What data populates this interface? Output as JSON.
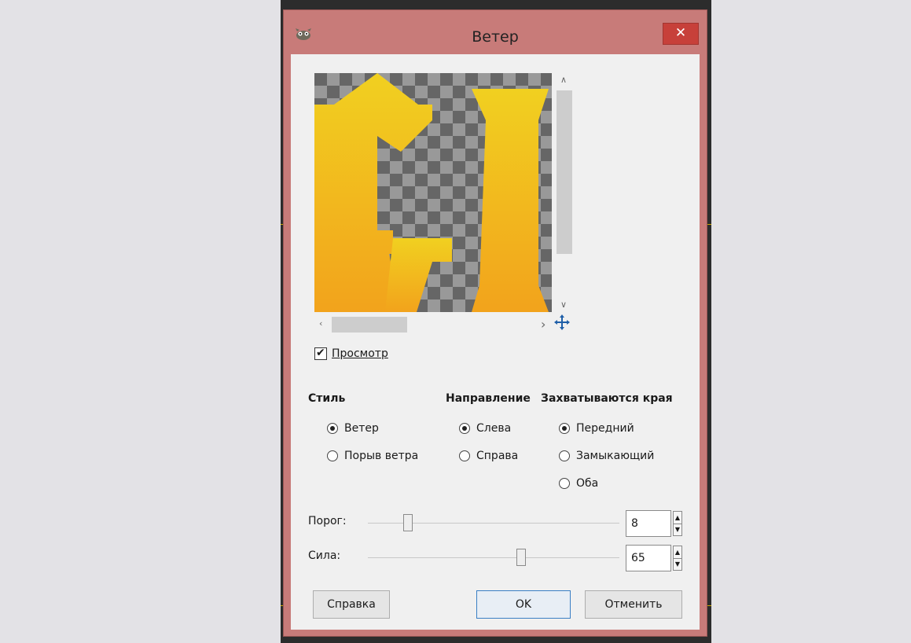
{
  "window": {
    "title": "Ветер",
    "close_label": "✕"
  },
  "preview": {
    "checkbox_label": "Просмотр",
    "checked": true
  },
  "groups": {
    "style": {
      "heading": "Стиль",
      "options": [
        "Ветер",
        "Порыв ветра"
      ],
      "selected": "Ветер"
    },
    "direction": {
      "heading": "Направление",
      "options": [
        "Слева",
        "Справа"
      ],
      "selected": "Слева"
    },
    "edges": {
      "heading": "Захватываются края",
      "options": [
        "Передний",
        "Замыкающий",
        "Оба"
      ],
      "selected": "Передний"
    }
  },
  "sliders": {
    "threshold": {
      "label": "Порог:",
      "value": "8"
    },
    "strength": {
      "label": "Сила:",
      "value": "65"
    }
  },
  "buttons": {
    "help": "Справка",
    "ok": "OK",
    "cancel": "Отменить"
  },
  "colors": {
    "titlebar": "#c87b79",
    "close": "#c7403a",
    "preview_yellow": "#f1d020",
    "preview_orange": "#f2a31c"
  }
}
